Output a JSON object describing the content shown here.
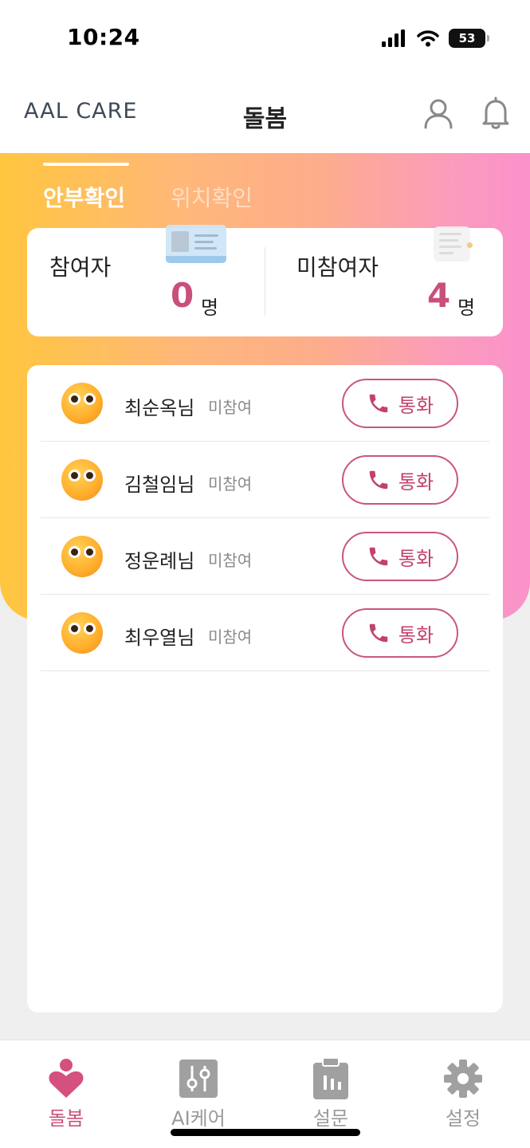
{
  "status_bar": {
    "time": "10:24",
    "battery": "53"
  },
  "header": {
    "logo": "AAL CARE",
    "title": "돌봄",
    "profile_icon": "person-icon",
    "bell_icon": "bell-icon"
  },
  "tabs": [
    {
      "label": "안부확인",
      "active": true
    },
    {
      "label": "위치확인",
      "active": false
    }
  ],
  "summary": {
    "participants": {
      "label": "참여자",
      "count": "0",
      "unit": "명"
    },
    "non_participants": {
      "label": "미참여자",
      "count": "4",
      "unit": "명"
    }
  },
  "people": [
    {
      "name": "최순옥님",
      "status": "미참여",
      "call_label": "통화"
    },
    {
      "name": "김철임님",
      "status": "미참여",
      "call_label": "통화"
    },
    {
      "name": "정운례님",
      "status": "미참여",
      "call_label": "통화"
    },
    {
      "name": "최우열님",
      "status": "미참여",
      "call_label": "통화"
    }
  ],
  "bottom_nav": [
    {
      "label": "돌봄",
      "icon": "heart-person-icon",
      "active": true
    },
    {
      "label": "AI케어",
      "icon": "sliders-icon",
      "active": false
    },
    {
      "label": "설문",
      "icon": "clipboard-icon",
      "active": false
    },
    {
      "label": "설정",
      "icon": "gear-icon",
      "active": false
    }
  ],
  "colors": {
    "accent": "#c94f7c",
    "gradient_start": "#ffc63f",
    "gradient_end": "#fb92cb",
    "inactive": "#9a9a9a"
  }
}
